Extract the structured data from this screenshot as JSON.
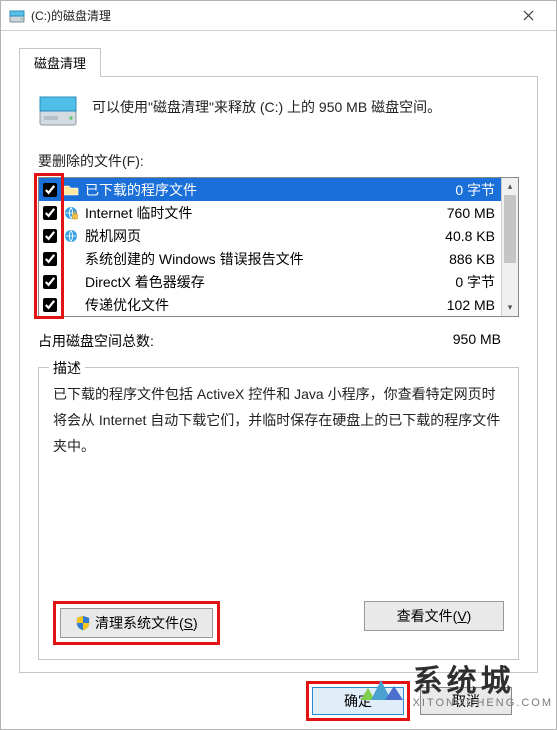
{
  "titlebar": {
    "title": "(C:)的磁盘清理"
  },
  "tab": {
    "label": "磁盘清理"
  },
  "intro": {
    "text": "可以使用\"磁盘清理\"来释放  (C:) 上的 950 MB 磁盘空间。"
  },
  "files_label": "要删除的文件(F):",
  "items": [
    {
      "label": "已下载的程序文件",
      "size": "0 字节",
      "checked": true,
      "selected": true,
      "icon": "folder"
    },
    {
      "label": "Internet 临时文件",
      "size": "760 MB",
      "checked": true,
      "selected": false,
      "icon": "ie-lock"
    },
    {
      "label": "脱机网页",
      "size": "40.8 KB",
      "checked": true,
      "selected": false,
      "icon": "ie"
    },
    {
      "label": "系统创建的 Windows 错误报告文件",
      "size": "886 KB",
      "checked": true,
      "selected": false,
      "icon": "blank"
    },
    {
      "label": "DirectX 着色器缓存",
      "size": "0 字节",
      "checked": true,
      "selected": false,
      "icon": "blank"
    },
    {
      "label": "传递优化文件",
      "size": "102 MB",
      "checked": true,
      "selected": false,
      "icon": "blank"
    }
  ],
  "total": {
    "label": "占用磁盘空间总数:",
    "value": "950 MB"
  },
  "description": {
    "group_title": "描述",
    "text": "已下载的程序文件包括 ActiveX 控件和 Java 小程序，你查看特定网页时将会从 Internet 自动下载它们，并临时保存在硬盘上的已下载的程序文件夹中。"
  },
  "buttons": {
    "clean_system": "清理系统文件(S)",
    "view_files": "查看文件(V)",
    "ok": "确定",
    "cancel": "取消"
  },
  "watermark": {
    "main": "系统城",
    "sub": "XITONGCHENG.COM"
  }
}
